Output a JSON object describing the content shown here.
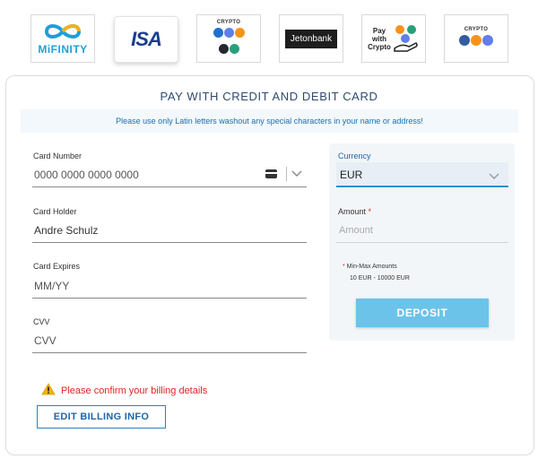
{
  "payment_methods": [
    {
      "name": "MiFinity",
      "label": "MiFINITY"
    },
    {
      "name": "Visa",
      "label": "ISA"
    },
    {
      "name": "Crypto",
      "label": "CRYPTO"
    },
    {
      "name": "Jetonbank",
      "label": "Jetonbank"
    },
    {
      "name": "Pay with Crypto",
      "label_lines": [
        "Pay",
        "with",
        "Crypto"
      ]
    },
    {
      "name": "Crypto",
      "label": "CRYPTO"
    }
  ],
  "title": "PAY WITH CREDIT AND DEBIT CARD",
  "notice": "Please use only Latin letters washout any special characters in your name or address!",
  "card_number": {
    "label": "Card Number",
    "placeholder": "0000 0000 0000 0000"
  },
  "card_holder": {
    "label": "Card Holder",
    "value": "Andre Schulz"
  },
  "card_expires": {
    "label": "Card Expires",
    "placeholder": "MM/YY"
  },
  "cvv": {
    "label": "CVV",
    "placeholder": "CVV"
  },
  "currency": {
    "label": "Currency",
    "value": "EUR"
  },
  "amount": {
    "label": "Amount",
    "required_mark": "*",
    "placeholder": "Amount"
  },
  "min_max": {
    "note": "* Min-Max Amounts",
    "range": "10 EUR - 10000 EUR"
  },
  "deposit_label": "DEPOSIT",
  "billing_warning": "Please confirm your billing details",
  "edit_billing_label": "EDIT BILLING INFO",
  "colors": {
    "accent": "#2c8fd0",
    "deposit": "#6cc3ea",
    "warning": "#e02424",
    "title": "#2e4a6e"
  }
}
